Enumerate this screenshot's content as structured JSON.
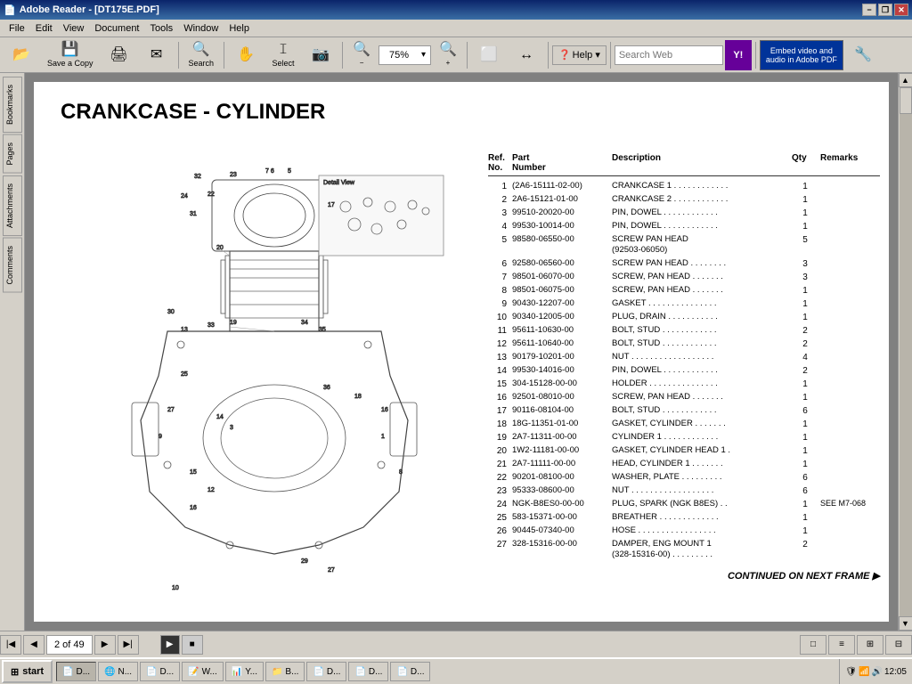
{
  "titlebar": {
    "title": "Adobe Reader - [DT175E.PDF]",
    "icon": "📄",
    "min": "−",
    "restore": "❐",
    "close": "✕"
  },
  "menubar": {
    "items": [
      "File",
      "Edit",
      "View",
      "Document",
      "Tools",
      "Window",
      "Help"
    ]
  },
  "toolbar": {
    "save_copy": "Save a Copy",
    "search": "Search",
    "select": "Select",
    "zoom_level": "75%",
    "help": "Help ▾",
    "search_web_placeholder": "Search Web",
    "embed_video": "Embed video and",
    "embed_video2": "audio in Adobe PDF"
  },
  "sidebar": {
    "panels": [
      "Bookmarks",
      "Pages",
      "Attachments",
      "Comments"
    ]
  },
  "document": {
    "title": "CRANKCASE - CYLINDER",
    "table_headers": {
      "ref_no": "Ref.\nNo.",
      "part_no": "Part\nNumber",
      "description": "Description",
      "qty": "Qty",
      "remarks": "Remarks"
    },
    "parts": [
      {
        "ref": "1",
        "part": "(2A6-15111-02-00)",
        "desc": "CRANKCASE 1 . . . . . . . . . . . .",
        "qty": "1",
        "rem": ""
      },
      {
        "ref": "2",
        "part": "2A6-15121-01-00",
        "desc": "CRANKCASE 2 . . . . . . . . . . . .",
        "qty": "1",
        "rem": ""
      },
      {
        "ref": "3",
        "part": "99510-20020-00",
        "desc": "PIN, DOWEL  . . . . . . . . . . . .",
        "qty": "1",
        "rem": ""
      },
      {
        "ref": "4",
        "part": "99530-10014-00",
        "desc": "PIN, DOWEL  . . . . . . . . . . . .",
        "qty": "1",
        "rem": ""
      },
      {
        "ref": "5",
        "part": "98580-06550-00",
        "desc": "SCREW PAN HEAD\n(92503-06050)",
        "qty": "5",
        "rem": ""
      },
      {
        "ref": "6",
        "part": "92580-06560-00",
        "desc": "SCREW PAN HEAD  . . . . . . . .",
        "qty": "3",
        "rem": ""
      },
      {
        "ref": "7",
        "part": "98501-06070-00",
        "desc": "SCREW, PAN HEAD  . . . . . . .",
        "qty": "3",
        "rem": ""
      },
      {
        "ref": "8",
        "part": "98501-06075-00",
        "desc": "SCREW, PAN HEAD  . . . . . . .",
        "qty": "1",
        "rem": ""
      },
      {
        "ref": "9",
        "part": "90430-12207-00",
        "desc": "GASKET  . . . . . . . . . . . . . . .",
        "qty": "1",
        "rem": ""
      },
      {
        "ref": "10",
        "part": "90340-12005-00",
        "desc": "PLUG, DRAIN  . . . . . . . . . . .",
        "qty": "1",
        "rem": ""
      },
      {
        "ref": "11",
        "part": "95611-10630-00",
        "desc": "BOLT, STUD  . . . . . . . . . . . .",
        "qty": "2",
        "rem": ""
      },
      {
        "ref": "12",
        "part": "95611-10640-00",
        "desc": "BOLT, STUD  . . . . . . . . . . . .",
        "qty": "2",
        "rem": ""
      },
      {
        "ref": "13",
        "part": "90179-10201-00",
        "desc": "NUT  . . . . . . . . . . . . . . . . . .",
        "qty": "4",
        "rem": ""
      },
      {
        "ref": "14",
        "part": "99530-14016-00",
        "desc": "PIN, DOWEL  . . . . . . . . . . . .",
        "qty": "2",
        "rem": ""
      },
      {
        "ref": "15",
        "part": "304-15128-00-00",
        "desc": "HOLDER  . . . . . . . . . . . . . . .",
        "qty": "1",
        "rem": ""
      },
      {
        "ref": "16",
        "part": "92501-08010-00",
        "desc": "SCREW, PAN HEAD  . . . . . . .",
        "qty": "1",
        "rem": ""
      },
      {
        "ref": "17",
        "part": "90116-08104-00",
        "desc": "BOLT, STUD  . . . . . . . . . . . .",
        "qty": "6",
        "rem": ""
      },
      {
        "ref": "18",
        "part": "18G-11351-01-00",
        "desc": "GASKET, CYLINDER  . . . . . . .",
        "qty": "1",
        "rem": ""
      },
      {
        "ref": "19",
        "part": "2A7-11311-00-00",
        "desc": "CYLINDER 1  . . . . . . . . . . . .",
        "qty": "1",
        "rem": ""
      },
      {
        "ref": "20",
        "part": "1W2-11181-00-00",
        "desc": "GASKET, CYLINDER HEAD 1  .",
        "qty": "1",
        "rem": ""
      },
      {
        "ref": "21",
        "part": "2A7-11111-00-00",
        "desc": "HEAD, CYLINDER 1  . . . . . . .",
        "qty": "1",
        "rem": ""
      },
      {
        "ref": "22",
        "part": "90201-08100-00",
        "desc": "WASHER, PLATE  . . . . . . . . .",
        "qty": "6",
        "rem": ""
      },
      {
        "ref": "23",
        "part": "95333-08600-00",
        "desc": "NUT  . . . . . . . . . . . . . . . . . .",
        "qty": "6",
        "rem": ""
      },
      {
        "ref": "24",
        "part": "NGK-B8ES0-00-00",
        "desc": "PLUG, SPARK (NGK B8ES)  . .",
        "qty": "1",
        "rem": "SEE M7-068"
      },
      {
        "ref": "25",
        "part": "583-15371-00-00",
        "desc": "BREATHER  . . . . . . . . . . . . .",
        "qty": "1",
        "rem": ""
      },
      {
        "ref": "26",
        "part": "90445-07340-00",
        "desc": "HOSE  . . . . . . . . . . . . . . . . .",
        "qty": "1",
        "rem": ""
      },
      {
        "ref": "27",
        "part": "328-15316-00-00",
        "desc": "DAMPER, ENG MOUNT 1\n(328-15316-00)  . . . . . . . . .",
        "qty": "2",
        "rem": ""
      }
    ],
    "continued_text": "CONTINUED ON NEXT FRAME ▶"
  },
  "navigation": {
    "page_indicator": "2 of 49"
  },
  "taskbar": {
    "start": "start",
    "items": [
      "N...",
      "D...",
      "W...",
      "Y...",
      "B...",
      "D...",
      "D...",
      "D..."
    ],
    "time": "12:05"
  }
}
